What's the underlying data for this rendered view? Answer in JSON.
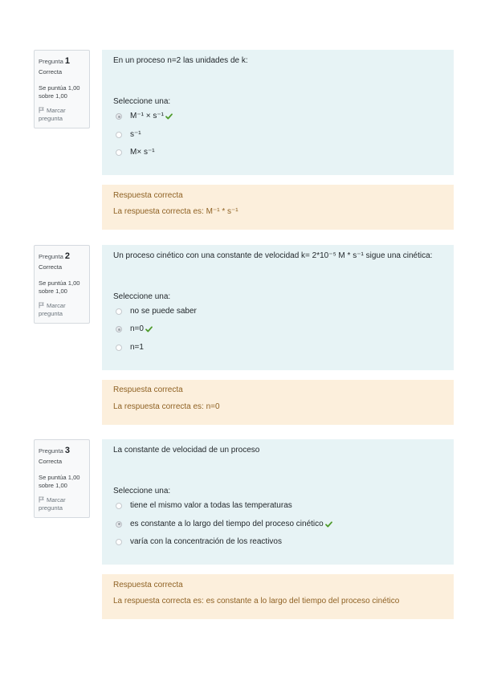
{
  "colors": {
    "formulation_bg": "#e7f3f5",
    "feedback_bg": "#fcefdc",
    "feedback_text": "#8f6224",
    "check": "#4f9b2b",
    "info_bg": "#f8f9fa",
    "info_border": "#d5dadf"
  },
  "icons": {
    "flag": "flag-icon",
    "correct": "check-icon"
  },
  "questions": [
    {
      "info": {
        "label": "Pregunta",
        "number": "1",
        "state": "Correcta",
        "grade": "Se puntúa 1,00 sobre 1,00",
        "flag": "Marcar pregunta"
      },
      "text": "En un proceso n=2 las unidades de k:",
      "prompt": "Seleccione una:",
      "options": [
        {
          "label": "M⁻¹ × s⁻¹",
          "selected": true,
          "correct_mark": true
        },
        {
          "label": "s⁻¹",
          "selected": false,
          "correct_mark": false
        },
        {
          "label": "M× s⁻¹",
          "selected": false,
          "correct_mark": false
        }
      ],
      "feedback": {
        "status": "Respuesta correcta",
        "right_answer": "La respuesta correcta es: M⁻¹ * s⁻¹"
      }
    },
    {
      "info": {
        "label": "Pregunta",
        "number": "2",
        "state": "Correcta",
        "grade": "Se puntúa 1,00 sobre 1,00",
        "flag": "Marcar pregunta"
      },
      "text": "Un proceso cinético con una constante de velocidad k= 2*10⁻⁵ M * s⁻¹ sigue una cinética:",
      "prompt": "Seleccione una:",
      "options": [
        {
          "label": "no se puede saber",
          "selected": false,
          "correct_mark": false
        },
        {
          "label": "n=0",
          "selected": true,
          "correct_mark": true
        },
        {
          "label": "n=1",
          "selected": false,
          "correct_mark": false
        }
      ],
      "feedback": {
        "status": "Respuesta correcta",
        "right_answer": "La respuesta correcta es: n=0"
      }
    },
    {
      "info": {
        "label": "Pregunta",
        "number": "3",
        "state": "Correcta",
        "grade": "Se puntúa 1,00 sobre 1,00",
        "flag": "Marcar pregunta"
      },
      "text": "La constante de velocidad de un proceso",
      "prompt": "Seleccione una:",
      "options": [
        {
          "label": "tiene el mismo valor a todas las temperaturas",
          "selected": false,
          "correct_mark": false
        },
        {
          "label": "es constante a lo largo del tiempo del proceso cinético",
          "selected": true,
          "correct_mark": true
        },
        {
          "label": "varía con la concentración de los reactivos",
          "selected": false,
          "correct_mark": false
        }
      ],
      "feedback": {
        "status": "Respuesta correcta",
        "right_answer": "La respuesta correcta es: es constante a lo largo del tiempo del proceso cinético"
      }
    }
  ]
}
